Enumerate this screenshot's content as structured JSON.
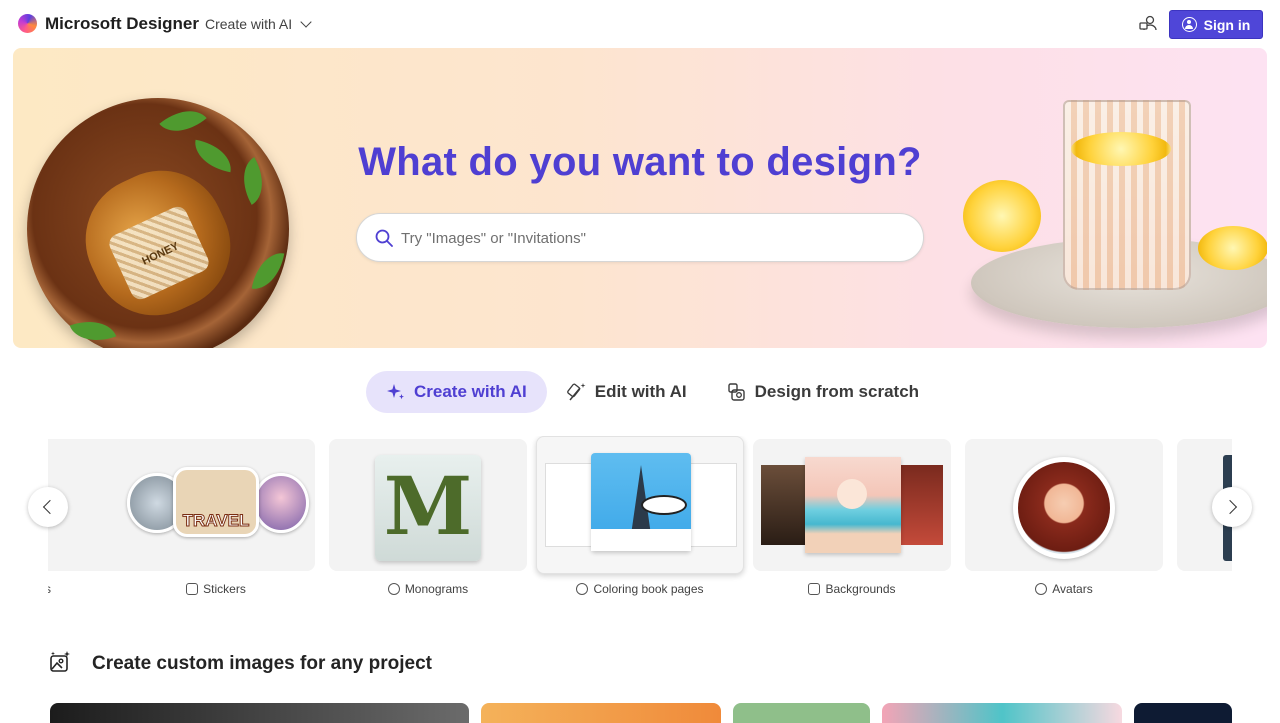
{
  "app": {
    "brand": "Microsoft Designer",
    "nav_menu": "Create with AI",
    "sign_in": "Sign in"
  },
  "hero": {
    "title": "What do you want to design?",
    "search_placeholder": "Try \"Images\" or \"Invitations\"",
    "jar_label": "HONEY"
  },
  "tabs": [
    {
      "label": "Create with AI",
      "active": true,
      "icon": "sparkle-icon"
    },
    {
      "label": "Edit with AI",
      "active": false,
      "icon": "magic-wand-icon"
    },
    {
      "label": "Design from scratch",
      "active": false,
      "icon": "shapes-icon"
    }
  ],
  "categories": [
    {
      "label": "s",
      "icon": ""
    },
    {
      "label": "Stickers",
      "icon": "sticker-icon"
    },
    {
      "label": "Monograms",
      "icon": "monogram-icon"
    },
    {
      "label": "Coloring book pages",
      "icon": "palette-icon"
    },
    {
      "label": "Backgrounds",
      "icon": "image-icon"
    },
    {
      "label": "Avatars",
      "icon": "avatar-icon"
    }
  ],
  "card_art": {
    "stickers_text": "TRAVEL",
    "monogram_letter": "M"
  },
  "section": {
    "title": "Create custom images for any project"
  },
  "colors": {
    "accent": "#4f3fd2",
    "button": "#4f46d8",
    "tab_active_bg": "#e7e3fb"
  }
}
